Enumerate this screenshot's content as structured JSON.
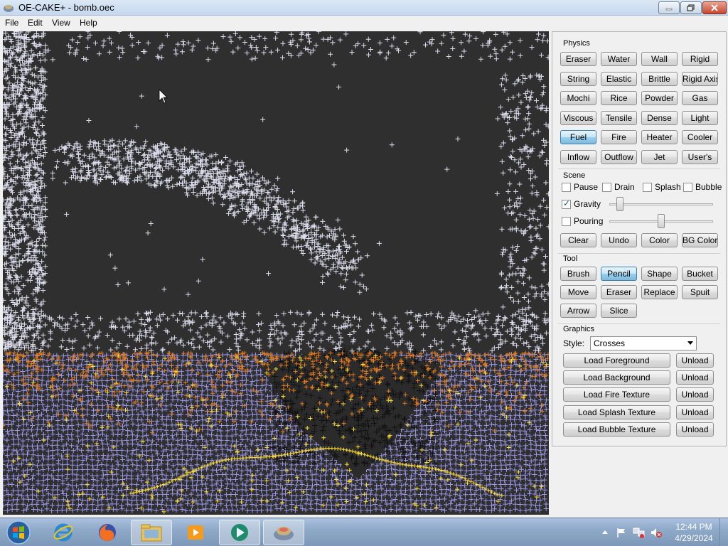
{
  "window": {
    "title": "OE-CAKE+ - bomb.oec"
  },
  "menu": [
    "File",
    "Edit",
    "View",
    "Help"
  ],
  "physics": {
    "label": "Physics",
    "buttons": [
      "Eraser",
      "Water",
      "Wall",
      "Rigid",
      "String",
      "Elastic",
      "Brittle",
      "Rigid Axis",
      "Mochi",
      "Rice",
      "Powder",
      "Gas",
      "Viscous",
      "Tensile",
      "Dense",
      "Light",
      "Fuel",
      "Fire",
      "Heater",
      "Cooler",
      "Inflow",
      "Outflow",
      "Jet",
      "User's"
    ],
    "selected": "Fuel"
  },
  "scene": {
    "label": "Scene",
    "checkboxes": [
      {
        "label": "Pause",
        "checked": false
      },
      {
        "label": "Drain",
        "checked": false
      },
      {
        "label": "Splash",
        "checked": false
      },
      {
        "label": "Bubble",
        "checked": false
      }
    ],
    "gravity": {
      "label": "Gravity",
      "checked": true,
      "level": 0.07
    },
    "pouring": {
      "label": "Pouring",
      "checked": false,
      "level": 0.5
    },
    "buttons": [
      "Clear",
      "Undo",
      "Color",
      "BG Color"
    ]
  },
  "tool": {
    "label": "Tool",
    "buttons": [
      "Brush",
      "Pencil",
      "Shape",
      "Bucket",
      "Move",
      "Eraser",
      "Replace",
      "Spuit",
      "Arrow",
      "Slice"
    ],
    "selected": "Pencil"
  },
  "graphics": {
    "label": "Graphics",
    "style_label": "Style:",
    "style_value": "Crosses",
    "loads": [
      "Load Foreground",
      "Load Background",
      "Load Fire Texture",
      "Load Splash Texture",
      "Load Bubble Texture"
    ],
    "unload_label": "Unload"
  },
  "taskbar": {
    "apps": [
      "start-orb",
      "internet-explorer",
      "firefox",
      "file-explorer",
      "media-player",
      "media-center",
      "oe-cake"
    ],
    "active_app": "oe-cake",
    "time": "12:44 PM",
    "date": "4/29/2024"
  },
  "colors": {
    "canvas_bg": "#2f2f2f",
    "water": "#9f9bf0",
    "smoke": "#ddddee",
    "fire": "#e07a1f",
    "spark": "#ffdd33",
    "rigid": "#111111"
  }
}
